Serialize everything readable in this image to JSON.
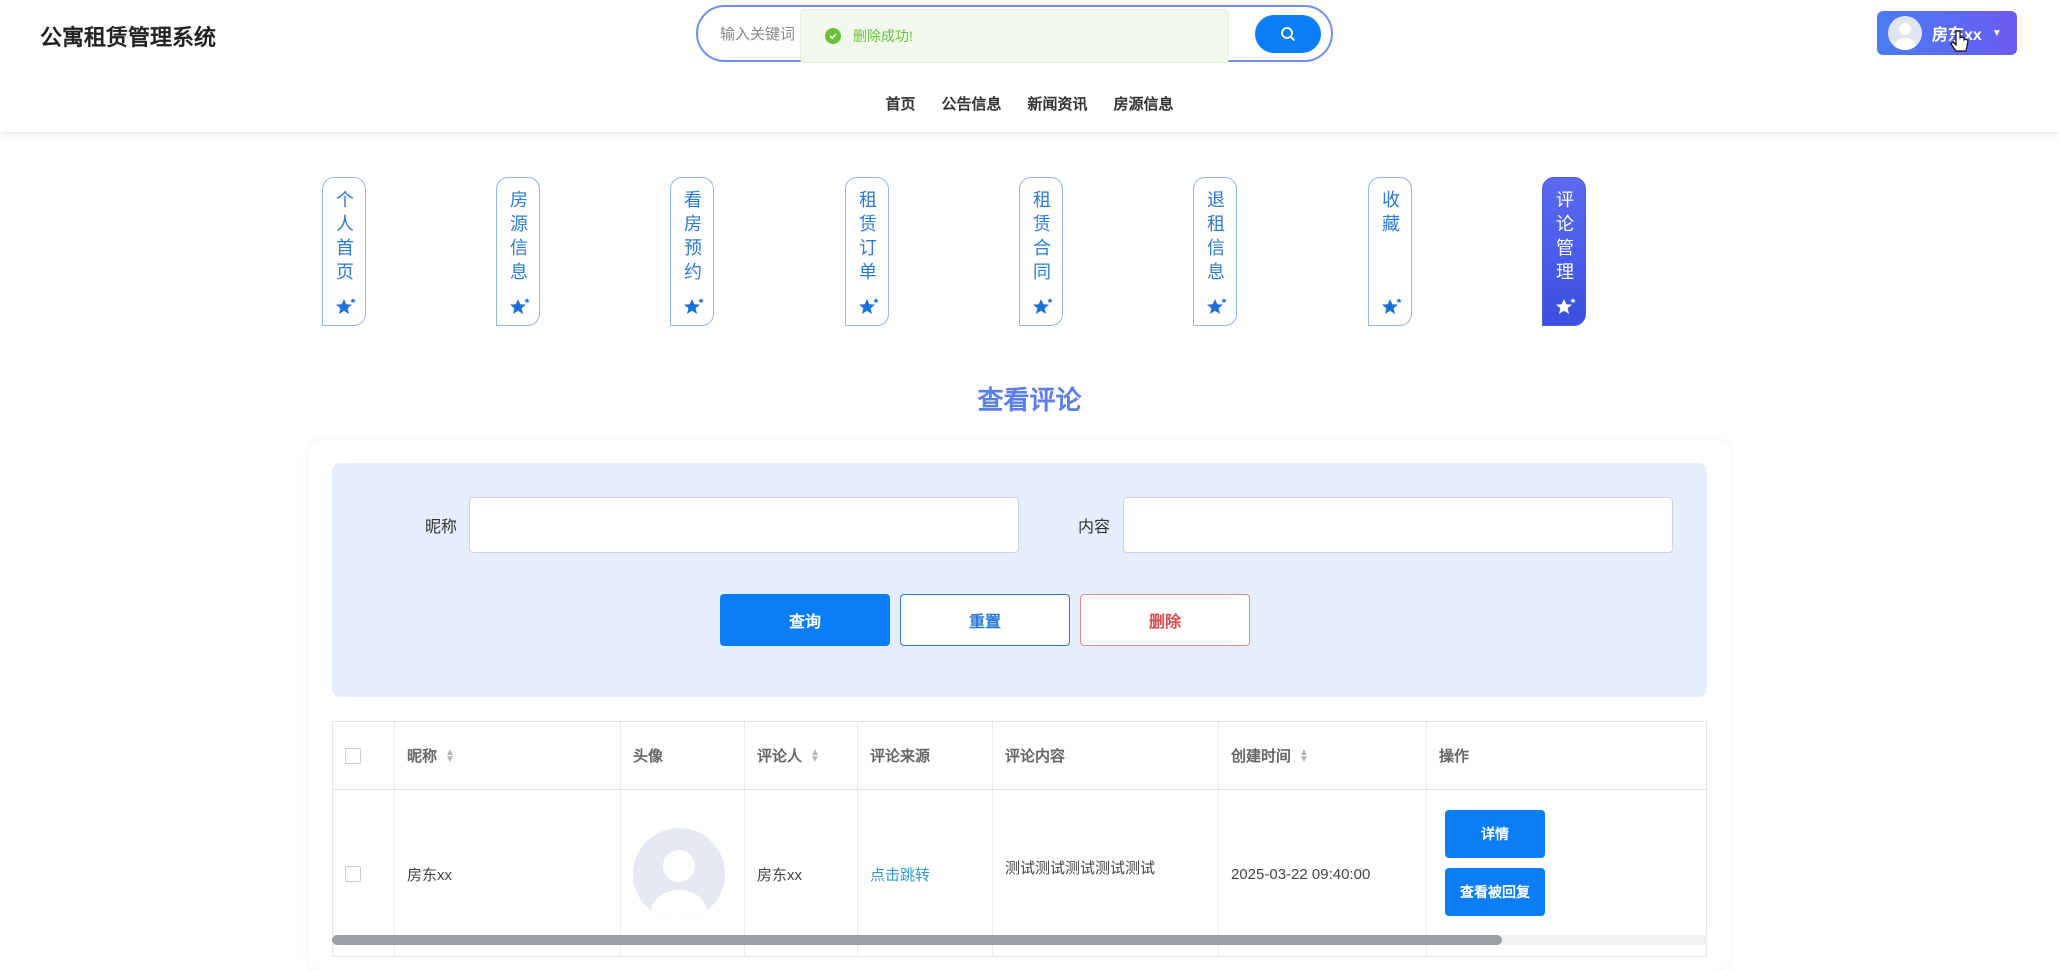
{
  "brand": "公寓租赁管理系统",
  "search": {
    "placeholder": "输入关键词"
  },
  "toast": {
    "message": "删除成功!"
  },
  "user": {
    "name": "房东xx"
  },
  "topnav": [
    "首页",
    "公告信息",
    "新闻资讯",
    "房源信息"
  ],
  "side_tabs": [
    {
      "label": "个人首页",
      "active": false
    },
    {
      "label": "房源信息",
      "active": false
    },
    {
      "label": "看房预约",
      "active": false
    },
    {
      "label": "租赁订单",
      "active": false
    },
    {
      "label": "租赁合同",
      "active": false
    },
    {
      "label": "退租信息",
      "active": false
    },
    {
      "label": "收藏",
      "active": false
    },
    {
      "label": "评论管理",
      "active": true
    }
  ],
  "section_title": "查看评论",
  "filter": {
    "nickname_label": "昵称",
    "content_label": "内容",
    "query_btn": "查询",
    "reset_btn": "重置",
    "delete_btn": "删除"
  },
  "table": {
    "headers": {
      "nickname": "昵称",
      "avatar": "头像",
      "commenter": "评论人",
      "source": "评论来源",
      "content": "评论内容",
      "created": "创建时间",
      "actions": "操作"
    },
    "rows": [
      {
        "nickname": "房东xx",
        "commenter": "房东xx",
        "source": "点击跳转",
        "content": "测试测试测试测试测试",
        "created": "2025-03-22 09:40:00",
        "detail_btn": "详情",
        "replied_btn": "查看被回复"
      }
    ]
  },
  "colors": {
    "primary": "#0b7ef5",
    "accent": "#5b6af0",
    "success": "#67c23a",
    "danger": "#e04b4b"
  }
}
